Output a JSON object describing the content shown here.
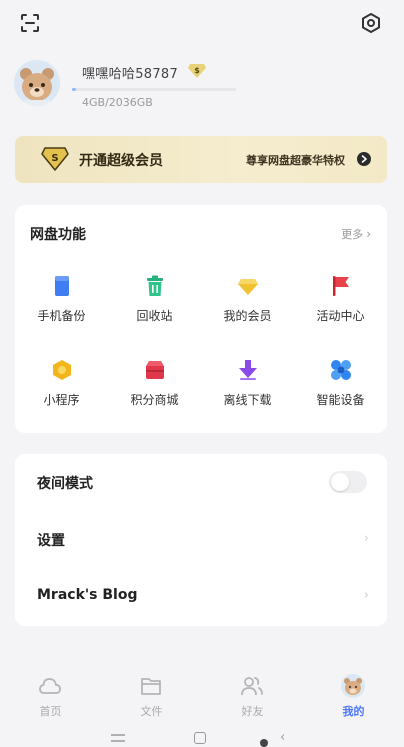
{
  "profile": {
    "username": "嘿嘿哈哈58787",
    "storage": "4GB/2036GB",
    "storage_used_fraction": 0.002
  },
  "vip_banner": {
    "title": "开通超级会员",
    "subtitle": "尊享网盘超豪华特权"
  },
  "functions": {
    "title": "网盘功能",
    "more": "更多",
    "items": [
      {
        "label": "手机备份",
        "icon": "phone-backup-icon"
      },
      {
        "label": "回收站",
        "icon": "recycle-bin-icon"
      },
      {
        "label": "我的会员",
        "icon": "membership-gem-icon"
      },
      {
        "label": "活动中心",
        "icon": "activity-flag-icon"
      },
      {
        "label": "小程序",
        "icon": "mini-program-icon"
      },
      {
        "label": "积分商城",
        "icon": "points-mall-icon"
      },
      {
        "label": "离线下载",
        "icon": "offline-download-icon"
      },
      {
        "label": "智能设备",
        "icon": "smart-device-icon"
      }
    ]
  },
  "settings": {
    "night_mode": "夜间模式",
    "night_mode_on": false,
    "settings": "设置",
    "blog": "Mrack's Blog"
  },
  "tabs": [
    {
      "label": "首页",
      "icon": "cloud-home-icon"
    },
    {
      "label": "文件",
      "icon": "folder-icon"
    },
    {
      "label": "好友",
      "icon": "friends-icon"
    },
    {
      "label": "我的",
      "icon": "avatar-tab-icon",
      "active": true
    }
  ],
  "colors": {
    "accent": "#4a77ff",
    "vip_gold": "#efe4bf"
  }
}
